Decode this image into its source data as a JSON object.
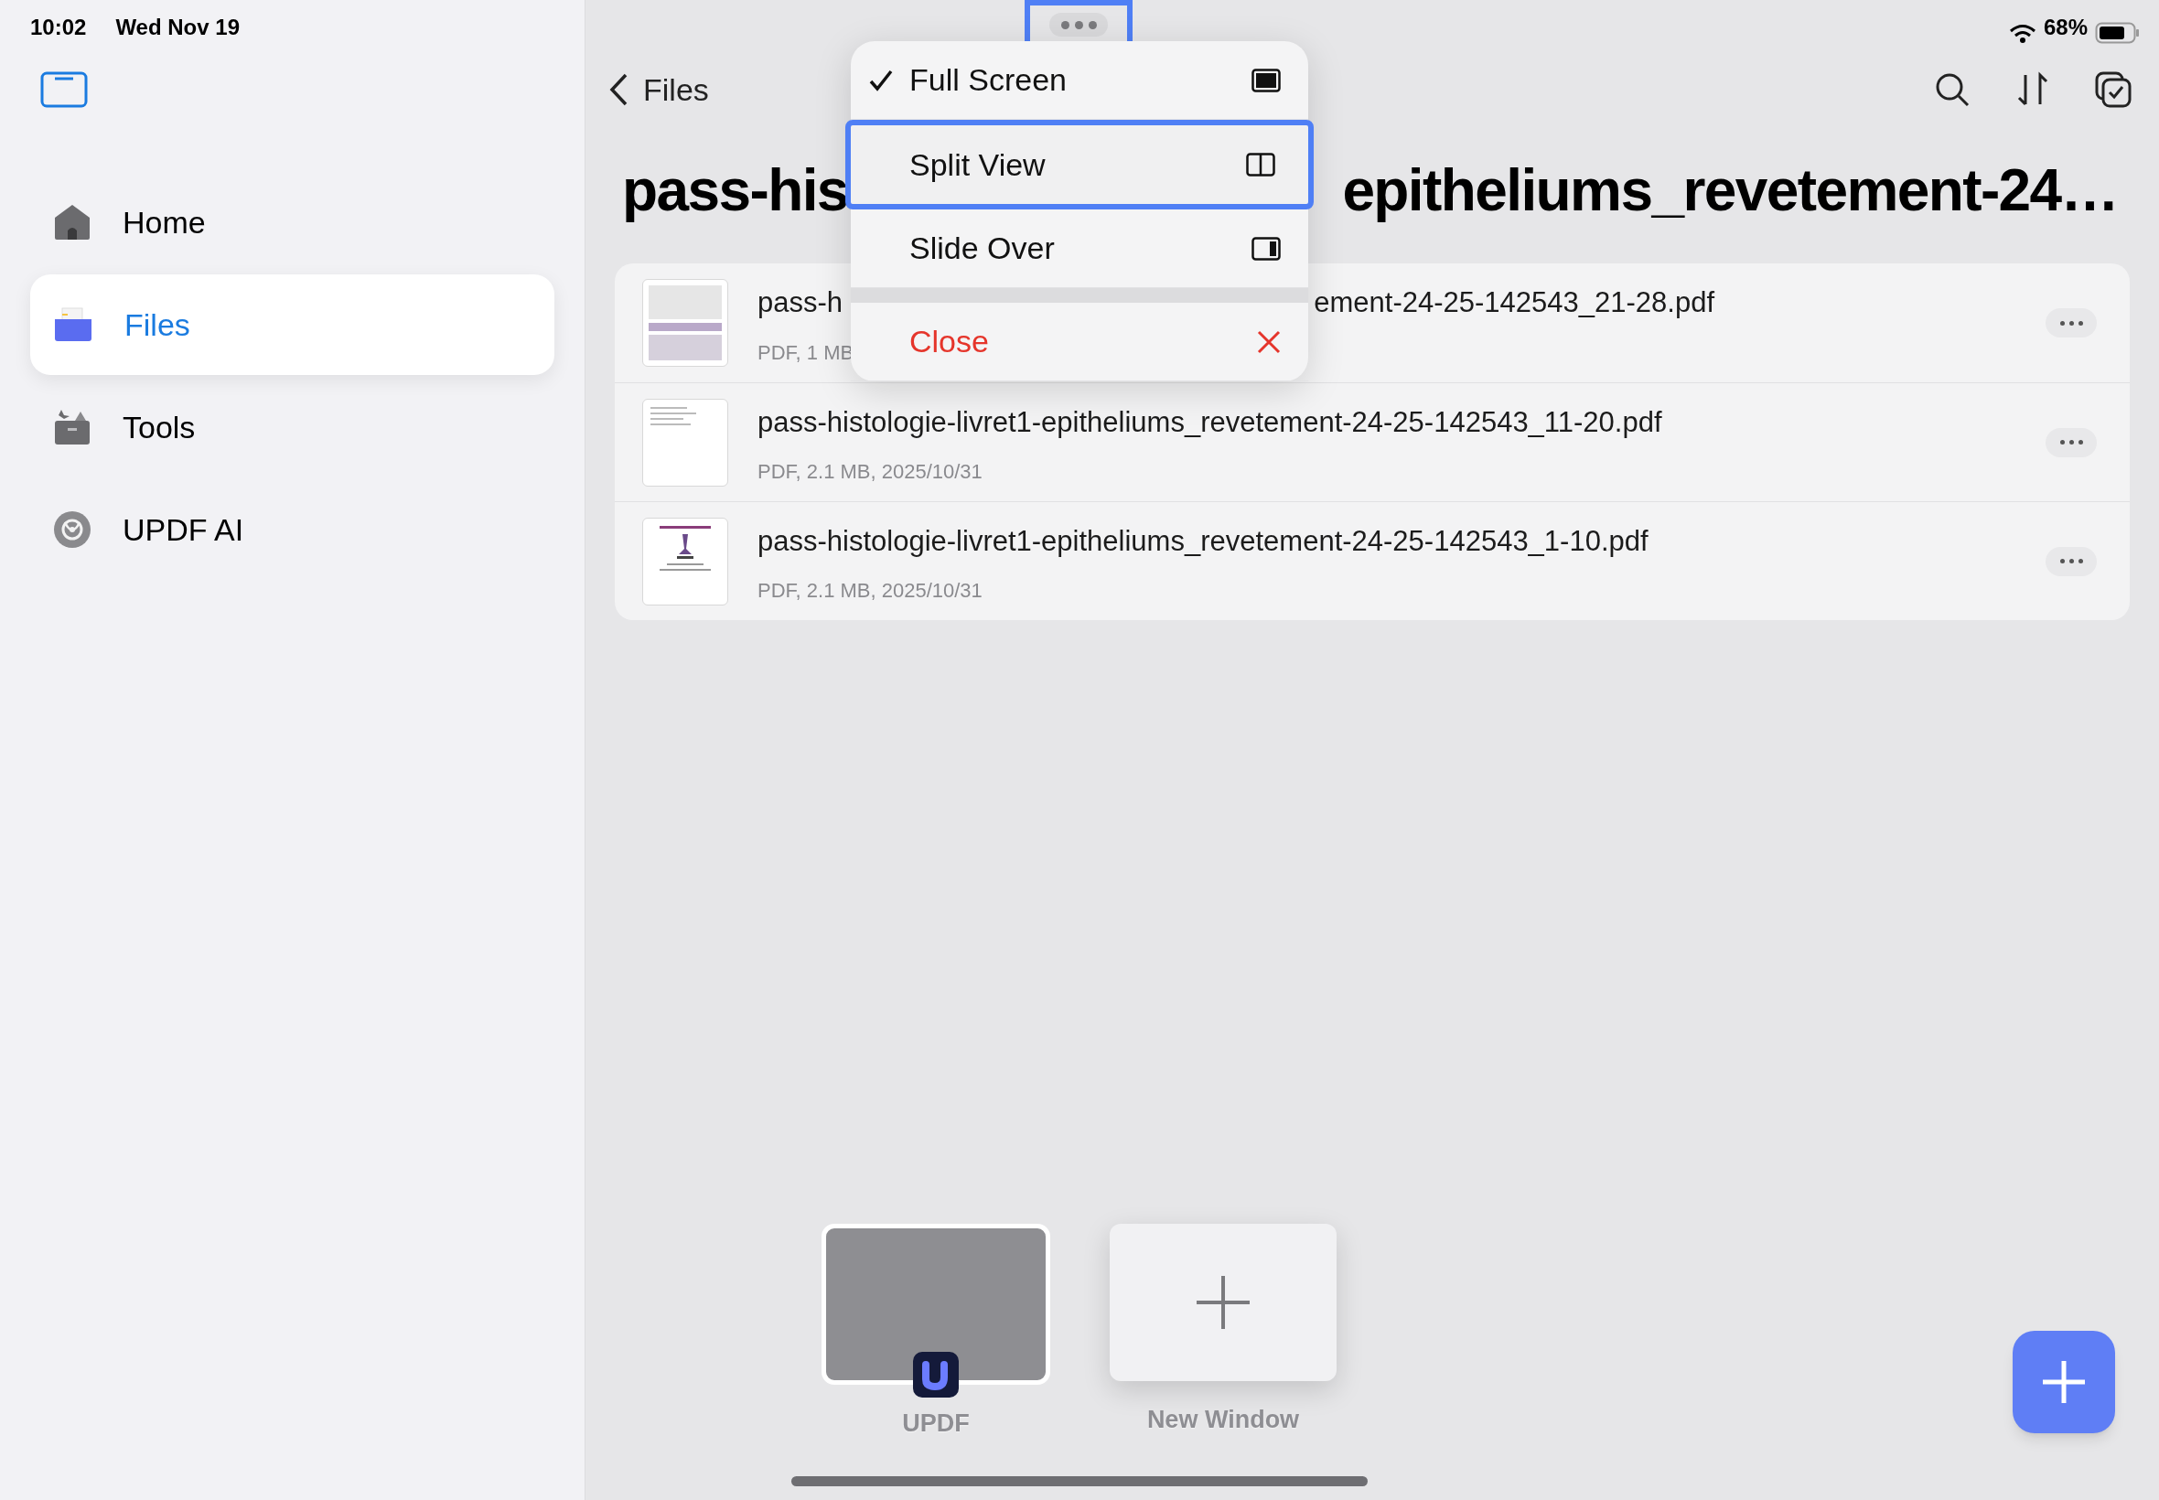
{
  "status_bar": {
    "time": "10:02",
    "date": "Wed Nov 19",
    "battery": "68%"
  },
  "sidebar": {
    "items": [
      {
        "label": "Home",
        "kind": "home",
        "selected": false
      },
      {
        "label": "Files",
        "kind": "files",
        "selected": true
      },
      {
        "label": "Tools",
        "kind": "tools",
        "selected": false
      },
      {
        "label": "UPDF AI",
        "kind": "ai",
        "selected": false
      }
    ]
  },
  "header": {
    "back_label": "Files",
    "title_left": "pass-his",
    "title_right": "epitheliums_revetement-24…"
  },
  "files": [
    {
      "name_left": "pass-h",
      "name_right": "ement-24-25-142543_21-28.pdf",
      "meta": "PDF, 1 MB",
      "kind": "dense"
    },
    {
      "name_left": "pass-histologie-livret1-epitheliums_revetement-24-25-142543_11-20.pdf",
      "meta": "PDF, 2.1 MB, 2025/10/31",
      "kind": "sparse"
    },
    {
      "name_left": "pass-histologie-livret1-epitheliums_revetement-24-25-142543_1-10.pdf",
      "meta": "PDF, 2.1 MB, 2025/10/31",
      "kind": "cover"
    }
  ],
  "window_menu": {
    "handle_highlighted": true,
    "items": [
      {
        "label": "Full Screen",
        "kind": "full",
        "checked": true,
        "highlighted": false
      },
      {
        "label": "Split View",
        "kind": "split",
        "checked": false,
        "highlighted": true
      },
      {
        "label": "Slide Over",
        "kind": "slide",
        "checked": false,
        "highlighted": false
      },
      {
        "label": "Close",
        "kind": "close",
        "checked": false,
        "highlighted": false
      }
    ]
  },
  "shelf": [
    {
      "label": "UPDF",
      "kind": "window"
    },
    {
      "label": "New Window",
      "kind": "new"
    }
  ]
}
